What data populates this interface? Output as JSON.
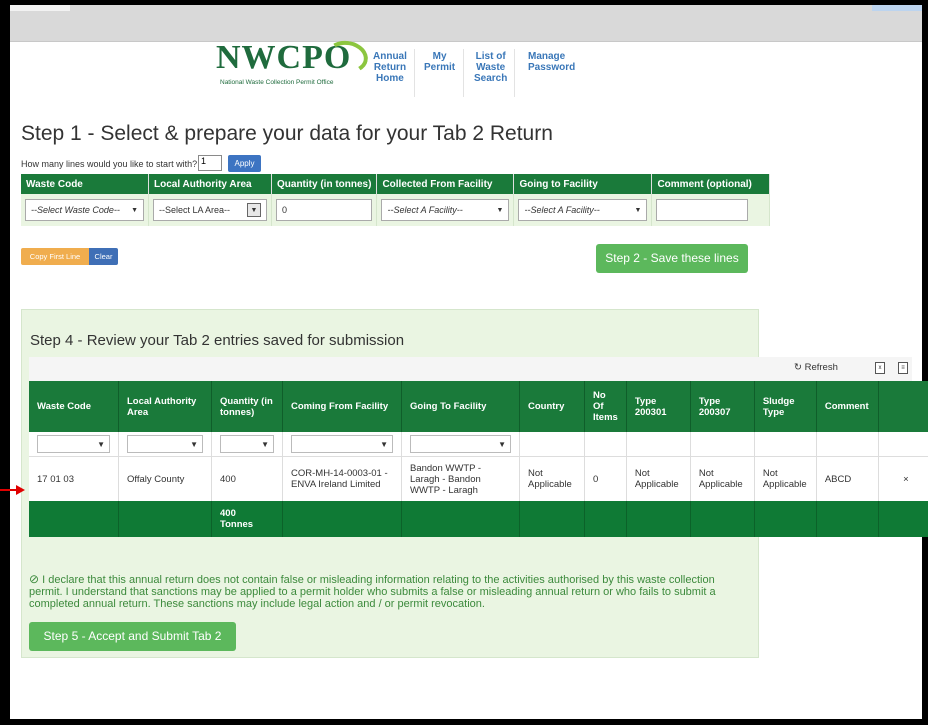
{
  "header": {
    "logo_text": "NWCPO",
    "logo_sub": "National Waste Collection Permit Office",
    "nav": [
      {
        "label_lines": [
          "Annual",
          "Return",
          "Home"
        ]
      },
      {
        "label_lines": [
          "My",
          "Permit"
        ]
      },
      {
        "label_lines": [
          "List of",
          "Waste",
          "Search"
        ]
      },
      {
        "label_lines": [
          "Manage",
          "Password"
        ]
      }
    ]
  },
  "step1": {
    "title": "Step 1 -  Select & prepare your data for your Tab 2 Return",
    "lines_prompt": "How many lines would you like to start with?",
    "lines_value": "1",
    "apply_label": "Apply",
    "columns": [
      "Waste Code",
      "Local Authority Area",
      "Quantity (in tonnes)",
      "Collected From Facility",
      "Going to Facility",
      "Comment (optional)"
    ],
    "waste_code_select": "--Select Waste Code--",
    "la_select": "--Select LA Area--",
    "quantity_value": "0",
    "from_facility_select": "--Select A Facility--",
    "to_facility_select": "--Select A Facility--",
    "comment_value": "",
    "copy_label": "Copy First Line",
    "clear_label": "Clear",
    "step2_label": "Step 2 - Save these lines"
  },
  "step4": {
    "title": "Step 4 - Review your Tab 2 entries saved for submission",
    "refresh_label": "Refresh",
    "columns": [
      [
        "Waste Code"
      ],
      [
        "Local Authority",
        "Area"
      ],
      [
        "Quantity (in",
        "tonnes)"
      ],
      [
        "Coming From Facility"
      ],
      [
        "Going To Facility"
      ],
      [
        "Country"
      ],
      [
        "No",
        "Of",
        "Items"
      ],
      [
        "Type",
        "200301"
      ],
      [
        "Type",
        "200307"
      ],
      [
        "Sludge",
        "Type"
      ],
      [
        "Comment"
      ]
    ],
    "row": {
      "waste_code": "17 01 03",
      "la_area": "Offaly County",
      "quantity": "400",
      "from_facility": [
        "COR-MH-14-0003-01 -",
        "ENVA Ireland Limited"
      ],
      "to_facility": [
        "Bandon WWTP -",
        "Laragh - Bandon",
        "WWTP - Laragh"
      ],
      "country": [
        "Not",
        "Applicable"
      ],
      "items": "0",
      "type200301": [
        "Not",
        "Applicable"
      ],
      "type200307": [
        "Not",
        "Applicable"
      ],
      "sludge": [
        "Not",
        "Applicable"
      ],
      "comment": "ABCD",
      "delete_glyph": "×"
    },
    "total": [
      "400",
      "Tonnes"
    ]
  },
  "declaration": "I declare that this annual return does not contain false or misleading information relating to the activities authorised by this waste collection permit. I understand that sanctions may be applied to a permit holder who submits a false or misleading annual return or who fails to submit a completed annual return. These sanctions may include legal action and / or permit revocation.",
  "step5_label": "Step 5 - Accept and Submit Tab 2",
  "colors": {
    "brand_green": "#1a7a3a",
    "action_green": "#5cb85c",
    "accent_orange": "#f0ad4e",
    "accent_blue": "#3d74c2",
    "annotation_red": "#e00000"
  }
}
